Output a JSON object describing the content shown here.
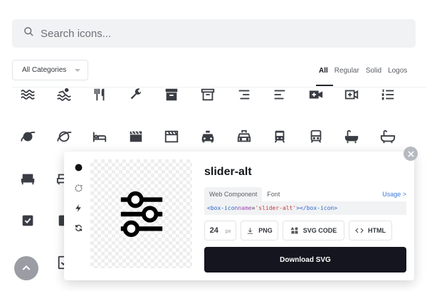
{
  "search": {
    "placeholder": "Search icons..."
  },
  "category_select": {
    "value": "All Categories"
  },
  "filters": [
    "All",
    "Regular",
    "Solid",
    "Logos"
  ],
  "grid_icons": [
    "water-icon",
    "swim-icon",
    "restaurant-icon",
    "wrench-icon",
    "archive-solid-icon",
    "archive-icon",
    "align-right-icon",
    "align-left-icon",
    "video-plus-solid-icon",
    "video-plus-icon",
    "list-ol-icon",
    "planet-solid-icon",
    "planet-icon",
    "hotel-icon",
    "movie-solid-icon",
    "movie-icon",
    "taxi-solid-icon",
    "taxi-icon",
    "train-solid-icon",
    "train-icon",
    "bath-solid-icon",
    "bath-icon",
    "bed-solid-icon",
    "bed-icon",
    "checkbox-checked-icon",
    "checkbox-partial-icon",
    "calendar-icon",
    "tablet-check-icon"
  ],
  "colors": {
    "accent": "#3b7dd8",
    "dark": "#14151f",
    "tag": "#2c66c8",
    "attr": "#a14bb5",
    "string": "#c33a3a"
  },
  "detail": {
    "name": "slider-alt",
    "variants": [
      "circle-dot-icon",
      "rotate-icon",
      "bolt-icon",
      "sync-icon"
    ],
    "tabs": [
      "Web Component",
      "Font"
    ],
    "usage": "Usage >",
    "code": {
      "open_tag": "<box-icon ",
      "attr": "name",
      "eq": "=",
      "value": "'slider-alt'",
      "close_tag": "></box-icon>"
    },
    "size": "24",
    "size_unit": "px",
    "png": "PNG",
    "svg_code": "SVG CODE",
    "html": "HTML",
    "download": "Download SVG"
  }
}
